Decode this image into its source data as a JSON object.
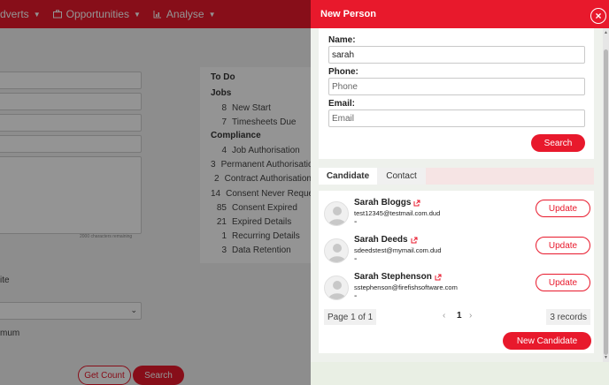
{
  "nav": {
    "items": [
      {
        "label": "dverts",
        "icon": "caret-down-icon"
      },
      {
        "label": "Opportunities",
        "icon": "briefcase-icon"
      },
      {
        "label": "Analyse",
        "icon": "bar-chart-icon"
      }
    ]
  },
  "background_form": {
    "char_note": "2000 characters remaining",
    "label_ite": "ite",
    "label_mum": "mum",
    "get_count_label": "Get Count",
    "search_label": "Search"
  },
  "todo": {
    "title": "To Do",
    "sections": [
      {
        "heading": "Jobs",
        "rows": [
          {
            "count": "8",
            "label": "New Start"
          },
          {
            "count": "7",
            "label": "Timesheets Due"
          }
        ]
      },
      {
        "heading": "Compliance",
        "rows": [
          {
            "count": "4",
            "label": "Job Authorisation"
          },
          {
            "count": "3",
            "label": "Permanent Authorisation"
          },
          {
            "count": "2",
            "label": "Contract Authorisation"
          },
          {
            "count": "14",
            "label": "Consent Never Requested"
          },
          {
            "count": "85",
            "label": "Consent Expired"
          },
          {
            "count": "21",
            "label": "Expired Details"
          },
          {
            "count": "1",
            "label": "Recurring Details"
          },
          {
            "count": "3",
            "label": "Data Retention"
          }
        ]
      }
    ]
  },
  "panel": {
    "title": "New Person",
    "close_label": "×",
    "form": {
      "name_label": "Name:",
      "name_value": "sarah",
      "phone_label": "Phone:",
      "phone_placeholder": "Phone",
      "email_label": "Email:",
      "email_placeholder": "Email",
      "search_label": "Search"
    },
    "tabs": [
      {
        "label": "Candidate",
        "active": true
      },
      {
        "label": "Contact",
        "active": false
      }
    ],
    "results": [
      {
        "name": "Sarah Bloggs",
        "email": "test12345@testmail.com.dud",
        "extra": "-",
        "action": "Update"
      },
      {
        "name": "Sarah Deeds",
        "email": "sdeedstest@mymail.com.dud",
        "extra": "-",
        "action": "Update"
      },
      {
        "name": "Sarah Stephenson",
        "email": "sstephenson@firefishsoftware.com",
        "extra": "-",
        "action": "Update"
      }
    ],
    "pager": {
      "info": "Page 1 of 1",
      "prev": "‹",
      "current": "1",
      "next": "›",
      "count": "3 records"
    },
    "new_candidate_label": "New Candidate"
  },
  "colors": {
    "accent": "#e8192c",
    "panel_bg": "#eef1ec"
  }
}
